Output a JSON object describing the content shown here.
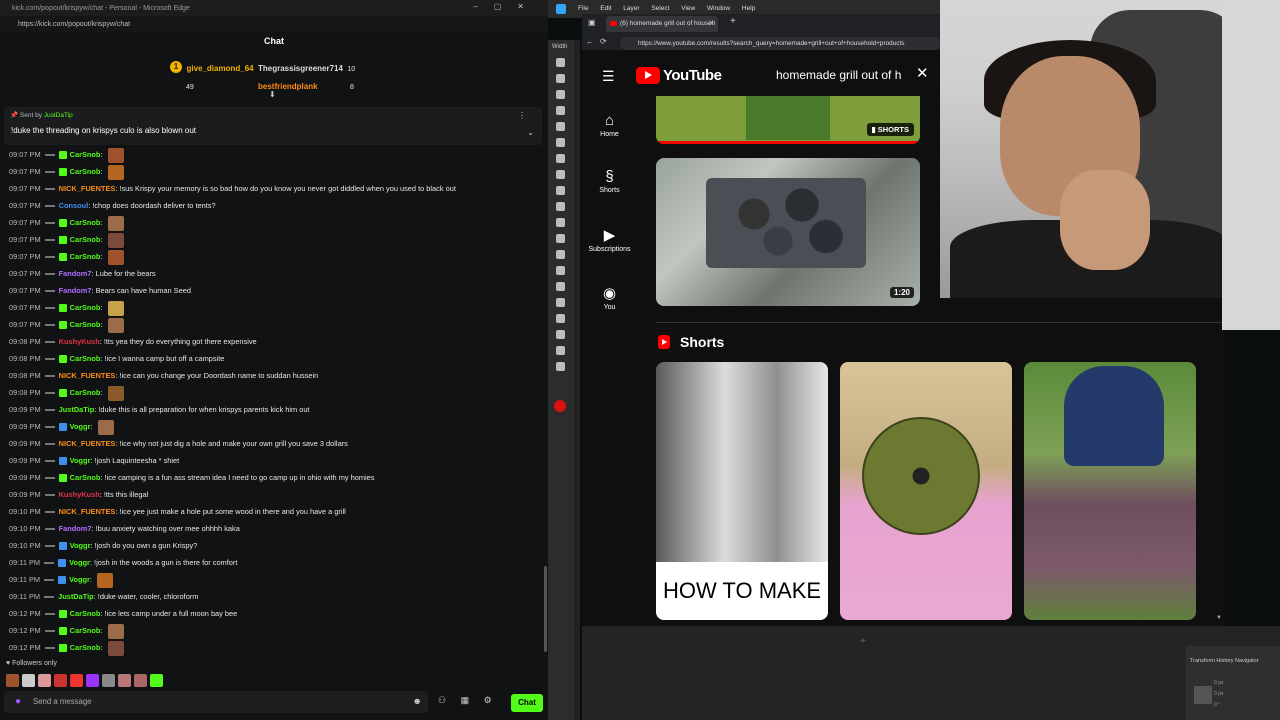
{
  "chat_window": {
    "title": "kick.com/popout/krispyw/chat - Personal - Microsoft Edge",
    "url": "https://kick.com/popout/krispyw/chat",
    "header": "Chat",
    "gifters": [
      {
        "name": "give_diamond_64",
        "count": "49"
      },
      {
        "name": "Thegrassisgreener714",
        "count": "10"
      },
      {
        "name": "bestfriendplank",
        "count": "8"
      }
    ],
    "pinned": {
      "sent_by": "Sent by",
      "sender": "JustDaTip",
      "text": "!duke the threading on krispys culo is also blown out"
    },
    "messages": [
      {
        "time": "09:07 PM",
        "user": "CarSnob",
        "color": "#53fc18",
        "badge": "green",
        "text": ""
      },
      {
        "time": "09:07 PM",
        "user": "CarSnob",
        "color": "#53fc18",
        "badge": "green",
        "text": ""
      },
      {
        "time": "09:07 PM",
        "user": "NICK_FUENTES",
        "color": "#ff8c1a",
        "badge": "dash",
        "text": "!sus Krispy your memory is so bad how do you know you never got diddled when you used to black out"
      },
      {
        "time": "09:07 PM",
        "user": "Consoul",
        "color": "#3d8ff0",
        "badge": "dash",
        "text": "!chop does doordash deliver to tents?"
      },
      {
        "time": "09:07 PM",
        "user": "CarSnob",
        "color": "#53fc18",
        "badge": "green",
        "text": ""
      },
      {
        "time": "09:07 PM",
        "user": "CarSnob",
        "color": "#53fc18",
        "badge": "green",
        "text": ""
      },
      {
        "time": "09:07 PM",
        "user": "CarSnob",
        "color": "#53fc18",
        "badge": "green",
        "text": ""
      },
      {
        "time": "09:07 PM",
        "user": "Fandom7",
        "color": "#b36cff",
        "badge": "dash",
        "text": "Lube for the bears"
      },
      {
        "time": "09:07 PM",
        "user": "Fandom7",
        "color": "#b36cff",
        "badge": "dash",
        "text": "Bears can have human Seed"
      },
      {
        "time": "09:07 PM",
        "user": "CarSnob",
        "color": "#53fc18",
        "badge": "green",
        "text": ""
      },
      {
        "time": "09:07 PM",
        "user": "CarSnob",
        "color": "#53fc18",
        "badge": "green",
        "text": ""
      },
      {
        "time": "09:08 PM",
        "user": "KushyKush",
        "color": "#e2334a",
        "badge": "dash",
        "text": "!tts yea they do everything got there expensive"
      },
      {
        "time": "09:08 PM",
        "user": "CarSnob",
        "color": "#53fc18",
        "badge": "green",
        "text": "!ice I wanna camp but off a campsite"
      },
      {
        "time": "09:08 PM",
        "user": "NICK_FUENTES",
        "color": "#ff8c1a",
        "badge": "dash",
        "text": "!ice can you change your Doordash name to suddan hussein"
      },
      {
        "time": "09:08 PM",
        "user": "CarSnob",
        "color": "#53fc18",
        "badge": "green",
        "text": ""
      },
      {
        "time": "09:09 PM",
        "user": "JustDaTip",
        "color": "#53fc18",
        "badge": "dash",
        "text": "!duke this is all preparation for when krispys parents kick him out"
      },
      {
        "time": "09:09 PM",
        "user": "Voggr",
        "color": "#53fc18",
        "badge": "blue",
        "text": ""
      },
      {
        "time": "09:09 PM",
        "user": "NICK_FUENTES",
        "color": "#ff8c1a",
        "badge": "dash",
        "text": "!ice why not just dig a hole and make your own grill you save 3 dollars"
      },
      {
        "time": "09:09 PM",
        "user": "Voggr",
        "color": "#53fc18",
        "badge": "blue",
        "text": "!josh Laquinteesha * shiet"
      },
      {
        "time": "09:09 PM",
        "user": "CarSnob",
        "color": "#53fc18",
        "badge": "green",
        "text": "!ice camping is a fun ass stream idea I need to go camp up in ohio with my homies"
      },
      {
        "time": "09:09 PM",
        "user": "KushyKush",
        "color": "#e2334a",
        "badge": "dash",
        "text": "!tts this illegal"
      },
      {
        "time": "09:10 PM",
        "user": "NICK_FUENTES",
        "color": "#ff8c1a",
        "badge": "dash",
        "text": "!ice yee just make a hole put some wood in there and you have a grill"
      },
      {
        "time": "09:10 PM",
        "user": "Fandom7",
        "color": "#b36cff",
        "badge": "dash",
        "text": "!buu anxiety watching over mee ohhhh kaka"
      },
      {
        "time": "09:10 PM",
        "user": "Voggr",
        "color": "#53fc18",
        "badge": "blue",
        "text": "!josh do you own a gun Krispy?"
      },
      {
        "time": "09:11 PM",
        "user": "Voggr",
        "color": "#53fc18",
        "badge": "blue",
        "text": "!josh in the woods a gun is there for comfort"
      },
      {
        "time": "09:11 PM",
        "user": "Voggr",
        "color": "#53fc18",
        "badge": "blue",
        "text": ""
      },
      {
        "time": "09:11 PM",
        "user": "JustDaTip",
        "color": "#53fc18",
        "badge": "dash",
        "text": "!duke water, cooler, chloroform"
      },
      {
        "time": "09:12 PM",
        "user": "CarSnob",
        "color": "#53fc18",
        "badge": "green",
        "text": "!ice lets camp under a full moon bay bee"
      },
      {
        "time": "09:12 PM",
        "user": "CarSnob",
        "color": "#53fc18",
        "badge": "green",
        "text": ""
      },
      {
        "time": "09:12 PM",
        "user": "CarSnob",
        "color": "#53fc18",
        "badge": "green",
        "text": ""
      }
    ],
    "followers_only": "Followers only",
    "input_placeholder": "Send a message",
    "send_button": "Chat"
  },
  "photoshop": {
    "menu": "File Edit Layer Select View Window Help",
    "width_label": "Width",
    "panel_tabs": "Transform  History  Navigator",
    "panel_rows": [
      "0 px",
      "0 px",
      "0 °"
    ]
  },
  "browser": {
    "tab_title": "(6) homemade grill out of househ",
    "url": "https://www.youtube.com/results?search_query=homemade+grill+out+of+household+products"
  },
  "youtube": {
    "logo": "YouTube",
    "search_query": "homemade grill out of h",
    "nav": [
      {
        "icon": "home-icon",
        "label": "Home"
      },
      {
        "icon": "shorts-icon",
        "label": "Shorts"
      },
      {
        "icon": "subscriptions-icon",
        "label": "Subscriptions"
      },
      {
        "icon": "you-icon",
        "label": "You"
      }
    ],
    "shorts_badge": "SHORTS",
    "video_duration": "1:20",
    "shorts_section_title": "Shorts",
    "short1_caption": "HOW TO MAKE"
  }
}
